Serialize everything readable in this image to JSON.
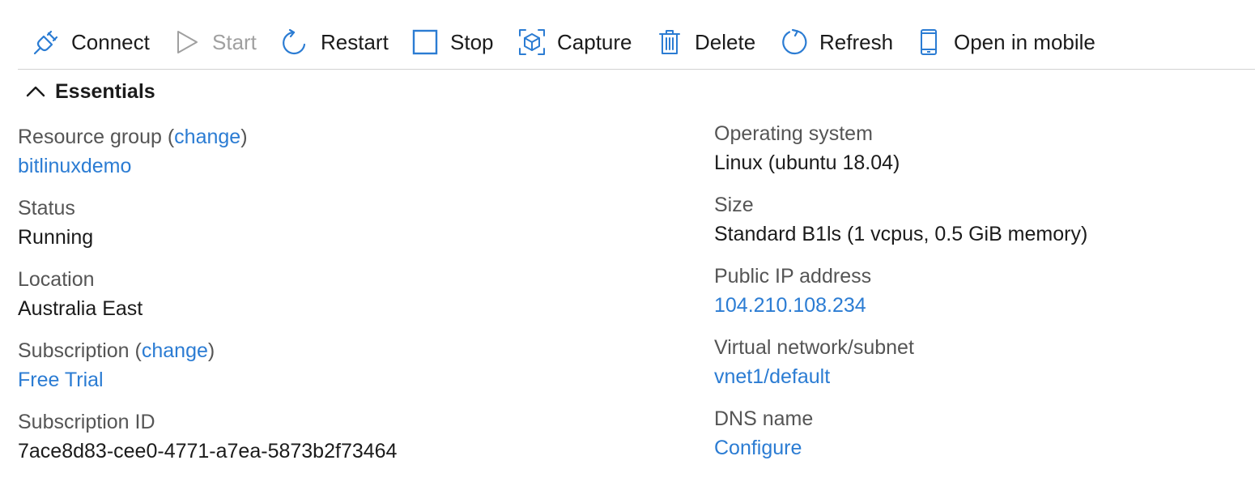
{
  "toolbar": {
    "connect_label": "Connect",
    "start_label": "Start",
    "restart_label": "Restart",
    "stop_label": "Stop",
    "capture_label": "Capture",
    "delete_label": "Delete",
    "refresh_label": "Refresh",
    "mobile_label": "Open in mobile"
  },
  "essentials": {
    "title": "Essentials"
  },
  "left": {
    "resource_group_label": "Resource group",
    "resource_group_change": "change",
    "resource_group_value": "bitlinuxdemo",
    "status_label": "Status",
    "status_value": "Running",
    "location_label": "Location",
    "location_value": "Australia East",
    "subscription_label": "Subscription",
    "subscription_change": "change",
    "subscription_value": "Free Trial",
    "subscription_id_label": "Subscription ID",
    "subscription_id_value": "7ace8d83-cee0-4771-a7ea-5873b2f73464"
  },
  "right": {
    "os_label": "Operating system",
    "os_value": "Linux (ubuntu 18.04)",
    "size_label": "Size",
    "size_value": "Standard B1ls (1 vcpus, 0.5 GiB memory)",
    "public_ip_label": "Public IP address",
    "public_ip_value": "104.210.108.234",
    "vnet_label": "Virtual network/subnet",
    "vnet_value": "vnet1/default",
    "dns_label": "DNS name",
    "dns_value": "Configure"
  },
  "colors": {
    "accent": "#2b7cd3",
    "label": "#555555",
    "text": "#1b1b1b",
    "disabled": "#a0a0a0",
    "divider": "#d2d2d2"
  },
  "icons": [
    "plug-icon",
    "play-icon",
    "restart-icon",
    "stop-icon",
    "capture-icon",
    "trash-icon",
    "refresh-icon",
    "mobile-icon",
    "chevron-up-icon"
  ]
}
